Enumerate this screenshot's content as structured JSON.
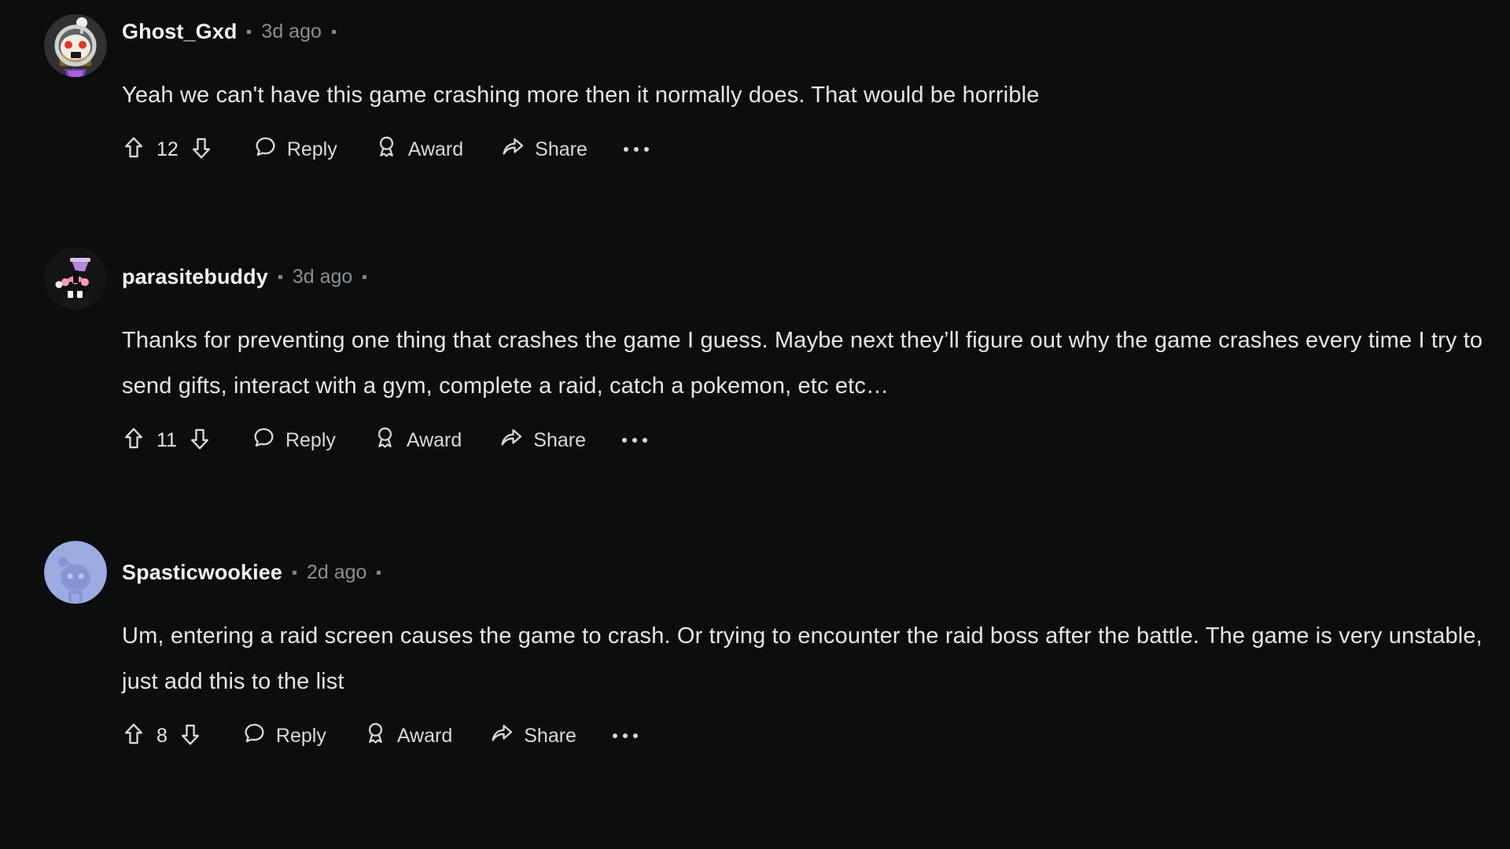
{
  "thread": {
    "comments": [
      {
        "username": "Ghost_Gxd",
        "timestamp": "3d ago",
        "body": "Yeah we can't have this game crashing more then it normally does. That would be horrible",
        "votes": "12",
        "reply_label": "Reply",
        "award_label": "Award",
        "share_label": "Share",
        "avatar_style": "astronaut-snoo"
      },
      {
        "username": "parasitebuddy",
        "timestamp": "3d ago",
        "body": "Thanks for preventing one thing that crashes the game I guess. Maybe next they’ll figure out why the game crashes every time I try to send gifts, interact with a gym, complete a raid, catch a pokemon, etc etc…",
        "votes": "11",
        "reply_label": "Reply",
        "award_label": "Award",
        "share_label": "Share",
        "avatar_style": "purple-hat-snoo"
      },
      {
        "username": "Spasticwookiee",
        "timestamp": "2d ago",
        "body": "Um, entering a raid screen causes the game to crash. Or trying to encounter the raid boss after the battle. The game is very unstable, just add this to the list",
        "votes": "8",
        "reply_label": "Reply",
        "award_label": "Award",
        "share_label": "Share",
        "avatar_style": "default-snoo"
      }
    ]
  },
  "icons": {
    "upvote": "upvote-arrow-icon",
    "downvote": "downvote-arrow-icon",
    "reply": "speech-bubble-icon",
    "award": "award-badge-icon",
    "share": "share-arrow-icon",
    "overflow": "overflow-menu-icon"
  },
  "colors": {
    "background": "#0b0d0e",
    "text": "#e4e6e8",
    "muted": "#8a9093",
    "avatar_blue": "#9cabe0"
  }
}
